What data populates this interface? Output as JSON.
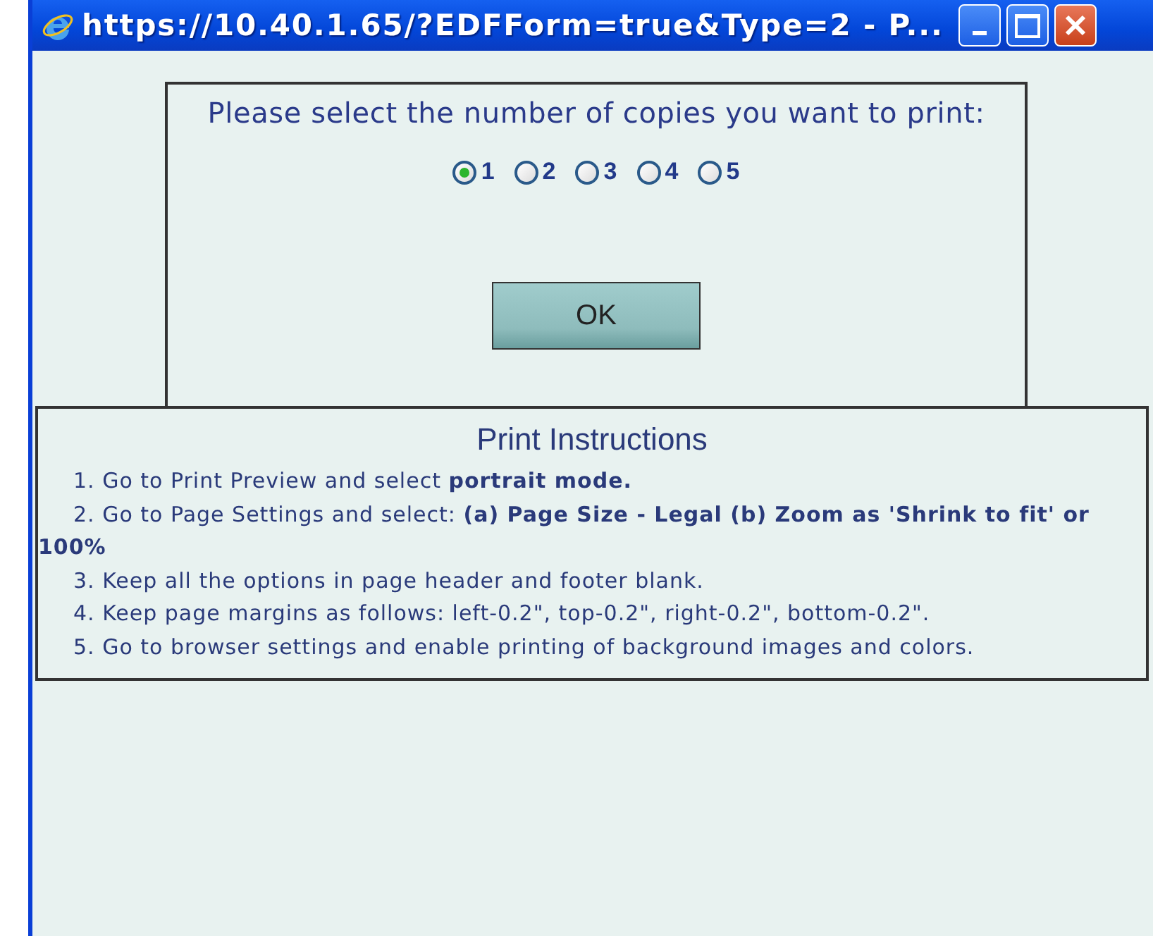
{
  "window": {
    "title": "https://10.40.1.65/?EDFForm=true&Type=2 - P..."
  },
  "copies": {
    "prompt": "Please select the number of copies you want to print:",
    "options": [
      {
        "label": "1",
        "selected": true
      },
      {
        "label": "2",
        "selected": false
      },
      {
        "label": "3",
        "selected": false
      },
      {
        "label": "4",
        "selected": false
      },
      {
        "label": "5",
        "selected": false
      }
    ],
    "ok_button": "OK"
  },
  "instructions": {
    "title": "Print Instructions",
    "items": [
      "1. Go to Print Preview and select **portrait mode.**",
      "2. Go to Page Settings and select: **(a) Page Size - Legal (b) Zoom as 'Shrink to fit' or 100%**",
      "3. Keep all the options in page header and footer blank.",
      "4. Keep page margins as follows: left-0.2\", top-0.2\", right-0.2\", bottom-0.2\".",
      "5. Go to browser settings and enable printing of background images and colors."
    ]
  }
}
